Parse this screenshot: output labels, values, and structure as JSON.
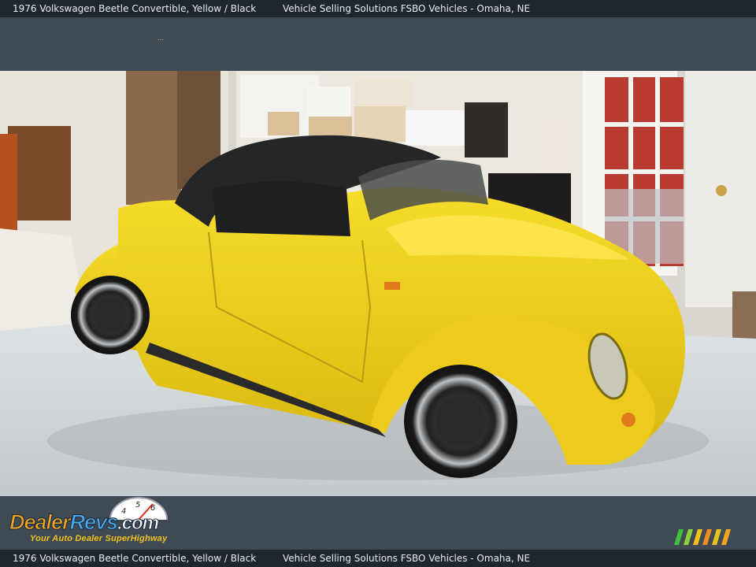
{
  "top_bar": {
    "vehicle": "1976 Volkswagen Beetle Convertible,  Yellow / Black",
    "seller": "Vehicle Selling Solutions FSBO Vehicles - Omaha, NE"
  },
  "header": {
    "dots": "..."
  },
  "photo": {
    "subject": "yellow-convertible-beetle-in-garage"
  },
  "footer": {
    "logo": {
      "brand_part1": "Dealer",
      "brand_part2": "Revs",
      "brand_part3": ".com",
      "tagline": "Your Auto Dealer SuperHighway",
      "gauge_digits": [
        "4",
        "5",
        "6"
      ]
    },
    "stripes_colors": [
      "#3fbf3f",
      "#8fd13a",
      "#f2c21c",
      "#f28c1c",
      "#e8c21c",
      "#f2a51c"
    ]
  },
  "bottom_bar": {
    "vehicle": "1976 Volkswagen Beetle Convertible,  Yellow / Black",
    "seller": "Vehicle Selling Solutions FSBO Vehicles - Omaha, NE"
  }
}
